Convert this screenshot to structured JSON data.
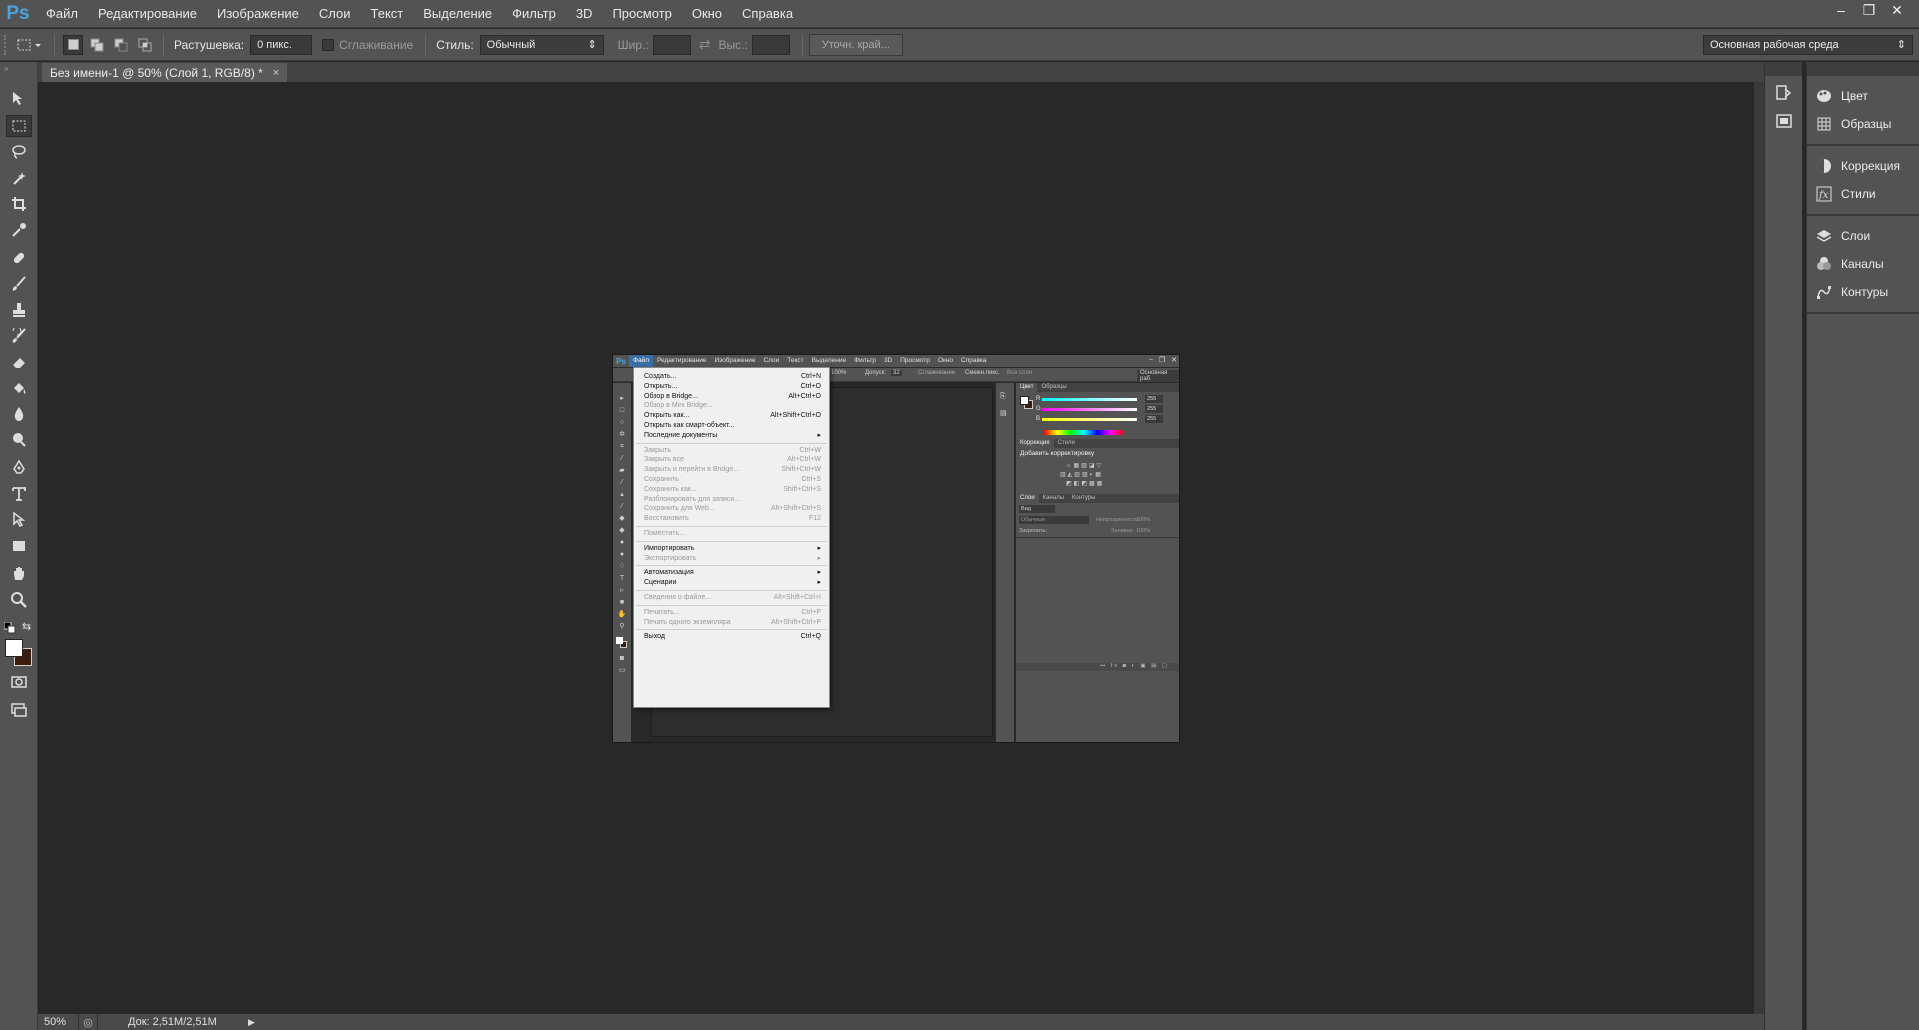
{
  "app": {
    "logo": "Ps",
    "menu": [
      "Файл",
      "Редактирование",
      "Изображение",
      "Слои",
      "Текст",
      "Выделение",
      "Фильтр",
      "3D",
      "Просмотр",
      "Окно",
      "Справка"
    ],
    "window_controls": [
      "–",
      "❐",
      "✕"
    ]
  },
  "options_bar": {
    "feather_label": "Растушевка:",
    "feather_value": "0 пикс.",
    "antialias_label": "Сглаживание",
    "style_label": "Стиль:",
    "style_value": "Обычный",
    "width_label": "Шир.:",
    "height_label": "Выс.:",
    "refine_edge": "Уточн. край...",
    "workspace": "Основная рабочая среда"
  },
  "document_tab": {
    "title": "Без имени-1 @ 50% (Слой 1, RGB/8) *",
    "close": "×"
  },
  "status_bar": {
    "zoom": "50%",
    "doc_info": "Док: 2,51M/2,51M"
  },
  "right_panels": {
    "group1": [
      "Цвет",
      "Образцы"
    ],
    "group2": [
      "Коррекция",
      "Стили"
    ],
    "group3": [
      "Слои",
      "Каналы",
      "Контуры"
    ]
  },
  "mini_screenshot": {
    "logo": "Ps",
    "menu": [
      "Файл",
      "Редактирование",
      "Изображение",
      "Слои",
      "Текст",
      "Выделение",
      "Фильтр",
      "3D",
      "Просмотр",
      "Окно",
      "Справка"
    ],
    "options": {
      "zoom": "100%",
      "tolerance_label": "Допуск:",
      "tolerance_value": "32",
      "antialias": "Сглаживание",
      "contiguous": "Смежн.пикс.",
      "all_layers": "Все слои",
      "workspace": "Основная раб"
    },
    "color_panel": {
      "tabs": [
        "Цвет",
        "Образцы"
      ],
      "sliders": [
        {
          "label": "R",
          "value": "255"
        },
        {
          "label": "G",
          "value": "255"
        },
        {
          "label": "B",
          "value": "255"
        }
      ]
    },
    "adjust_panel": {
      "tabs": [
        "Коррекция",
        "Стили"
      ],
      "title": "Добавить корректировку"
    },
    "layers_panel": {
      "tabs": [
        "Слои",
        "Каналы",
        "Контуры"
      ],
      "kind_label": "Вид",
      "blend_mode": "Обычные",
      "opacity_label": "Непрозрачность:",
      "opacity_value": "100%",
      "lock_label": "Закрепить:",
      "fill_label": "Заливка:",
      "fill_value": "100%"
    },
    "file_menu": [
      {
        "label": "Создать...",
        "shortcut": "Ctrl+N",
        "disabled": false
      },
      {
        "label": "Открыть...",
        "shortcut": "Ctrl+O",
        "disabled": false
      },
      {
        "label": "Обзор в Bridge...",
        "shortcut": "Alt+Ctrl+O",
        "disabled": false
      },
      {
        "label": "Обзор в Mini Bridge...",
        "shortcut": "",
        "disabled": true
      },
      {
        "label": "Открыть как...",
        "shortcut": "Alt+Shift+Ctrl+O",
        "disabled": false
      },
      {
        "label": "Открыть как смарт-объект...",
        "shortcut": "",
        "disabled": false
      },
      {
        "label": "Последние документы",
        "shortcut": "▸",
        "disabled": false
      },
      {
        "label": "Закрыть",
        "shortcut": "Ctrl+W",
        "disabled": true
      },
      {
        "label": "Закрыть все",
        "shortcut": "Alt+Ctrl+W",
        "disabled": true
      },
      {
        "label": "Закрыть и перейти в Bridge...",
        "shortcut": "Shift+Ctrl+W",
        "disabled": true
      },
      {
        "label": "Сохранить",
        "shortcut": "Ctrl+S",
        "disabled": true
      },
      {
        "label": "Сохранить как...",
        "shortcut": "Shift+Ctrl+S",
        "disabled": true
      },
      {
        "label": "Разблокировать для записи...",
        "shortcut": "",
        "disabled": true
      },
      {
        "label": "Сохранить для Web...",
        "shortcut": "Alt+Shift+Ctrl+S",
        "disabled": true
      },
      {
        "label": "Восстановить",
        "shortcut": "F12",
        "disabled": true
      },
      {
        "label": "Поместить...",
        "shortcut": "",
        "disabled": true
      },
      {
        "label": "Импортировать",
        "shortcut": "▸",
        "disabled": false
      },
      {
        "label": "Экспортировать",
        "shortcut": "▸",
        "disabled": true
      },
      {
        "label": "Автоматизация",
        "shortcut": "▸",
        "disabled": false
      },
      {
        "label": "Сценарии",
        "shortcut": "▸",
        "disabled": false
      },
      {
        "label": "Сведения о файле...",
        "shortcut": "Alt+Shift+Ctrl+I",
        "disabled": true
      },
      {
        "label": "Печатать...",
        "shortcut": "Ctrl+P",
        "disabled": true
      },
      {
        "label": "Печать одного экземпляра",
        "shortcut": "Alt+Shift+Ctrl+P",
        "disabled": true
      },
      {
        "label": "Выход",
        "shortcut": "Ctrl+Q",
        "disabled": false
      }
    ]
  },
  "colors": {
    "ui_bg": "#535353",
    "canvas_bg": "#282828",
    "accent": "#4aa3df",
    "foreground_color": "#ffffff",
    "background_color": "#3a1e10"
  }
}
